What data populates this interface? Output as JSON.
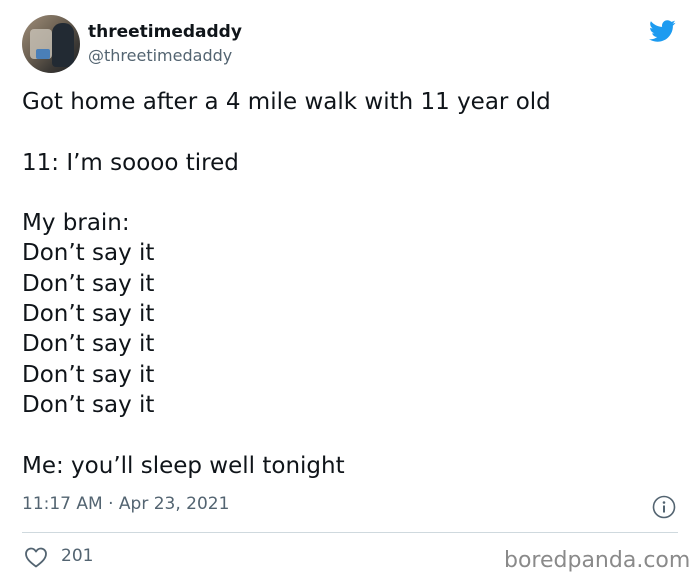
{
  "author": {
    "display_name": "threetimedaddy",
    "handle": "@threetimedaddy"
  },
  "tweet": {
    "lines": [
      "Got home after a 4 mile walk with 11 year old",
      "",
      "11: I’m soooo tired",
      "",
      "My brain:",
      "Don’t say it",
      "Don’t say it",
      "Don’t say it",
      "Don’t say it",
      "Don’t say it",
      "Don’t say it",
      "",
      "Me: you’ll sleep well tonight"
    ],
    "timestamp": "11:17 AM · Apr 23, 2021",
    "like_count": "201"
  },
  "icons": {
    "platform": "twitter-bird-icon",
    "info": "info-icon",
    "like": "heart-icon"
  },
  "colors": {
    "twitter_blue": "#1d9bf0",
    "text_primary": "#0f1419",
    "text_secondary": "#536471",
    "divider": "#cfd9de"
  },
  "watermark": "boredpanda.com"
}
